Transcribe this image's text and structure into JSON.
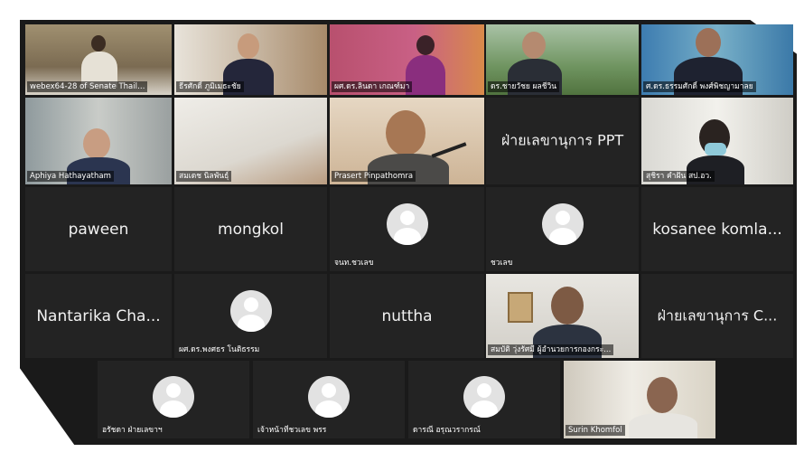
{
  "participants": {
    "row1": [
      "webex64-28 of Senate Thail…",
      "ธีรศักดิ์ ภูมิเมธะชัย",
      "ผศ.ดร.ลินดา เกณฑ์มา",
      "ดร.ชายวัชย ผลชีวิน",
      "ศ.ดร.ธรรมศักดิ์ พงศ์พิชญามาลย"
    ],
    "row2": [
      "Aphiya Hathayatham",
      "สมเดช นิลพันธุ์",
      "Prasert Pinpathomra",
      "ฝ่ายเลขานุการ PPT",
      "สุชิรา คำฝัน สป.อว."
    ],
    "row3": [
      "paween",
      "mongkol",
      "จนท.ชวเลข",
      "ชวเลข",
      "kosanee komla..."
    ],
    "row4": [
      "Nantarika Cha...",
      "ผศ.ดร.พงศธร โนติธรรม",
      "nuttha",
      "สมบัติ วุ่งรัศมี ผู้อำนวยการกองกระ...",
      "ฝ่ายเลขานุการ C..."
    ],
    "row5": [
      "อรัชดา ฝ่ายเลขาฯ",
      "เจ้าหน้าที่ชวเลข พรร",
      "ดารณี อรุณวรากรณ์",
      "Surin Khomfol"
    ]
  }
}
